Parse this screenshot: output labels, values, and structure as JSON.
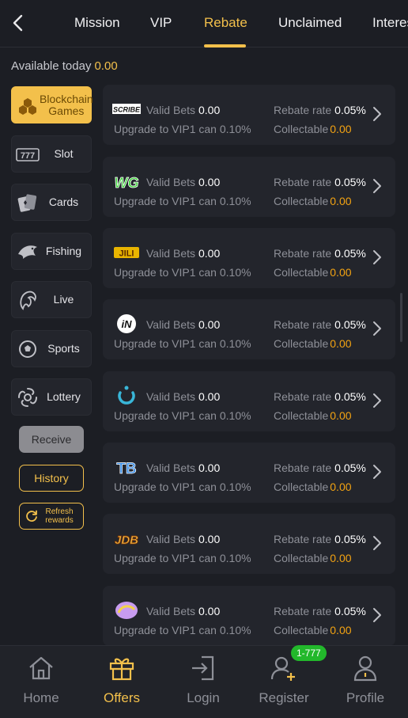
{
  "header": {
    "tabs": [
      {
        "label": "Mission"
      },
      {
        "label": "VIP"
      },
      {
        "label": "Rebate"
      },
      {
        "label": "Unclaimed"
      },
      {
        "label": "Interes"
      }
    ],
    "active_tab": "Rebate"
  },
  "available": {
    "label": "Available today",
    "amount": "0.00"
  },
  "categories": [
    {
      "label": "Blockchain Games",
      "icon": "blockchain-icon"
    },
    {
      "label": "Slot",
      "icon": "slot-777-icon"
    },
    {
      "label": "Cards",
      "icon": "cards-icon"
    },
    {
      "label": "Fishing",
      "icon": "fish-icon"
    },
    {
      "label": "Live",
      "icon": "live-dealer-icon"
    },
    {
      "label": "Sports",
      "icon": "soccer-ball-icon"
    },
    {
      "label": "Lottery",
      "icon": "lottery-icon"
    }
  ],
  "actions": {
    "receive": "Receive",
    "history": "History",
    "refresh": "Refresh rewards"
  },
  "providers": [
    {
      "logo": "scribe-logo",
      "logo_text": "SCRIBE",
      "valid_bets_label": "Valid Bets",
      "valid_bets": "0.00",
      "upgrade": "Upgrade to VIP1 can 0.10%",
      "rate_label": "Rebate rate",
      "rate": "0.05%",
      "collect_label": "Collectable",
      "collect": "0.00"
    },
    {
      "logo": "wg-logo",
      "logo_text": "WG",
      "valid_bets_label": "Valid Bets",
      "valid_bets": "0.00",
      "upgrade": "Upgrade to VIP1 can 0.10%",
      "rate_label": "Rebate rate",
      "rate": "0.05%",
      "collect_label": "Collectable",
      "collect": "0.00"
    },
    {
      "logo": "jili-logo",
      "logo_text": "JILI",
      "valid_bets_label": "Valid Bets",
      "valid_bets": "0.00",
      "upgrade": "Upgrade to VIP1 can 0.10%",
      "rate_label": "Rebate rate",
      "rate": "0.05%",
      "collect_label": "Collectable",
      "collect": "0.00"
    },
    {
      "logo": "in-logo",
      "logo_text": "iN",
      "valid_bets_label": "Valid Bets",
      "valid_bets": "0.00",
      "upgrade": "Upgrade to VIP1 can 0.10%",
      "rate_label": "Rebate rate",
      "rate": "0.05%",
      "collect_label": "Collectable",
      "collect": "0.00"
    },
    {
      "logo": "u-logo",
      "logo_text": "",
      "valid_bets_label": "Valid Bets",
      "valid_bets": "0.00",
      "upgrade": "Upgrade to VIP1 can 0.10%",
      "rate_label": "Rebate rate",
      "rate": "0.05%",
      "collect_label": "Collectable",
      "collect": "0.00"
    },
    {
      "logo": "tb-logo",
      "logo_text": "TB",
      "valid_bets_label": "Valid Bets",
      "valid_bets": "0.00",
      "upgrade": "Upgrade to VIP1 can 0.10%",
      "rate_label": "Rebate rate",
      "rate": "0.05%",
      "collect_label": "Collectable",
      "collect": "0.00"
    },
    {
      "logo": "jdb-logo",
      "logo_text": "JDB",
      "valid_bets_label": "Valid Bets",
      "valid_bets": "0.00",
      "upgrade": "Upgrade to VIP1 can 0.10%",
      "rate_label": "Rebate rate",
      "rate": "0.05%",
      "collect_label": "Collectable",
      "collect": "0.00"
    },
    {
      "logo": "ms-logo",
      "logo_text": "",
      "valid_bets_label": "Valid Bets",
      "valid_bets": "0.00",
      "upgrade": "Upgrade to VIP1 can 0.10%",
      "rate_label": "Rebate rate",
      "rate": "0.05%",
      "collect_label": "Collectable",
      "collect": "0.00"
    }
  ],
  "bottom_nav": [
    {
      "label": "Home",
      "icon": "home-icon"
    },
    {
      "label": "Offers",
      "icon": "gift-icon"
    },
    {
      "label": "Login",
      "icon": "login-icon"
    },
    {
      "label": "Register",
      "icon": "register-icon"
    },
    {
      "label": "Profile",
      "icon": "profile-icon"
    }
  ],
  "register_badge": "1-777",
  "colors": {
    "accent": "#f3c04b",
    "collectable": "#f3a312",
    "background": "#1c1e24",
    "card": "#23252c",
    "badge": "#22b82b"
  }
}
